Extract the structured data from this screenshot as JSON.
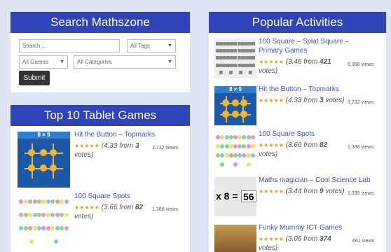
{
  "search": {
    "heading": "Search Mathszone",
    "query_placeholder": "Search ...",
    "tags_select": "All Tags",
    "games_select": "All Games",
    "categories_select": "All Categories",
    "submit_label": "Submit"
  },
  "top10": {
    "heading": "Top 10 Tablet Games",
    "items": [
      {
        "title": "Hit the Button – Topmarks",
        "stars": "★★★★★",
        "rating_prefix": "(4.33 from",
        "vote_count": "3",
        "rating_suffix": "votes)",
        "views": "3,732 views",
        "thumb_text": "8 × 9"
      },
      {
        "title": "100 Square Spots",
        "stars": "★★★★★",
        "rating_prefix": "(3.66 from",
        "vote_count": "82",
        "rating_suffix": "votes)",
        "views": "1,386 views"
      }
    ]
  },
  "popular": {
    "heading": "Popular Activities",
    "items": [
      {
        "title": "100 Square – Splat Square – Primary Games",
        "stars": "★★★★★",
        "rating_prefix": "(3.46 from",
        "vote_count": "421",
        "rating_suffix": "votes)",
        "views": "6,368 views"
      },
      {
        "title": "Hit the Button – Topmarks",
        "stars": "★★★★★",
        "rating_prefix": "(4.33 from",
        "vote_count": "3",
        "rating_suffix": "votes)",
        "views": "3,732 views",
        "thumb_text": "8 × 9"
      },
      {
        "title": "100 Square Spots",
        "stars": "★★★★★",
        "rating_prefix": "(3.66 from",
        "vote_count": "82",
        "rating_suffix": "votes)",
        "views": "1,386 views"
      },
      {
        "title": "Maths magician – Cool Science Lab",
        "stars": "★★★★★",
        "rating_prefix": "(3.44 from",
        "vote_count": "9",
        "rating_suffix": "votes)",
        "views": "1,335 views",
        "thumb_text_left": "x  8  =",
        "thumb_text_right": "56"
      },
      {
        "title": "Funky Mummy ICT Games",
        "stars": "★★★★★",
        "rating_prefix": "(3.06 from",
        "vote_count": "374",
        "rating_suffix": "votes)",
        "views": "661 views"
      }
    ]
  },
  "colors": {
    "page_bg": "#dde4f3",
    "header_bg": "#2f44b8",
    "link": "#3d50d8",
    "star": "#e19b27"
  }
}
